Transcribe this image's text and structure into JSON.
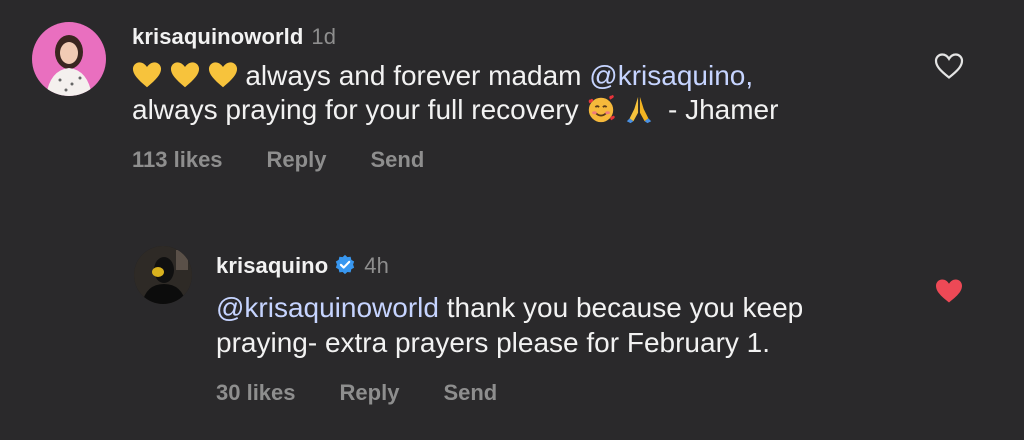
{
  "comments": [
    {
      "username": "krisaquinoworld",
      "time": "1d",
      "line1_prefix_emoji": "yellow-heart-icon x3",
      "line1_text": "always and forever madam",
      "line1_mention": "@krisaquino,",
      "line2_text": "always praying for your full recovery",
      "line2_suffix": "- Jhamer",
      "likes": "113 likes",
      "reply_label": "Reply",
      "send_label": "Send",
      "liked": false
    },
    {
      "username": "krisaquino",
      "verified": true,
      "time": "4h",
      "line1_mention": "@krisaquinoworld",
      "line1_text": "thank you because you keep",
      "line2_text": "praying- extra prayers please for February 1.",
      "likes": "30 likes",
      "reply_label": "Reply",
      "send_label": "Send",
      "liked": true
    }
  ],
  "colors": {
    "background": "#2a292b",
    "text": "#f2f2f2",
    "muted": "#8e8e8e",
    "mention": "#c6d4ff",
    "liked_heart": "#ed4956",
    "verified_badge": "#3897f0"
  }
}
